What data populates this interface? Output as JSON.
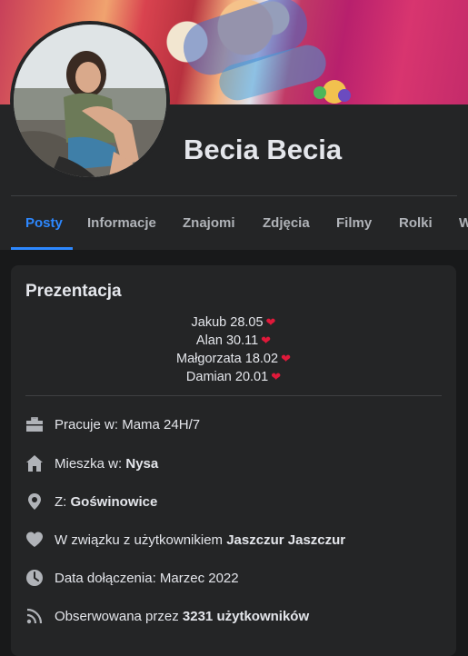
{
  "profile": {
    "name": "Becia Becia"
  },
  "tabs": [
    {
      "label": "Posty",
      "active": true
    },
    {
      "label": "Informacje"
    },
    {
      "label": "Znajomi"
    },
    {
      "label": "Zdjęcia"
    },
    {
      "label": "Filmy"
    },
    {
      "label": "Rolki"
    },
    {
      "label": "W"
    }
  ],
  "intro": {
    "title": "Prezentacja",
    "bio_lines": [
      "Jakub 28.05",
      "Alan 30.11",
      "Małgorzata 18.02",
      "Damian 20.01"
    ],
    "heart": "❤",
    "items": [
      {
        "icon": "briefcase-icon",
        "prefix": "Pracuje w: ",
        "value": "Mama 24H/7",
        "value_bold": false,
        "suffix": ""
      },
      {
        "icon": "home-icon",
        "prefix": "Mieszka w: ",
        "value": "Nysa",
        "value_bold": true,
        "suffix": ""
      },
      {
        "icon": "location-pin-icon",
        "prefix": "Z: ",
        "value": "Goświnowice",
        "value_bold": true,
        "suffix": ""
      },
      {
        "icon": "heart-icon",
        "prefix": "W związku z użytkownikiem ",
        "value": "Jaszczur Jaszczur",
        "value_bold": true,
        "suffix": ""
      },
      {
        "icon": "clock-icon",
        "prefix": "Data dołączenia: ",
        "value": "Marzec 2022",
        "value_bold": false,
        "suffix": ""
      },
      {
        "icon": "rss-icon",
        "prefix": "Obserwowana przez ",
        "value": "3231 użytkowników",
        "value_bold": true,
        "suffix": ""
      }
    ]
  },
  "colors": {
    "background": "#18191a",
    "card": "#242526",
    "accent": "#2d88ff",
    "heart": "#e0193a",
    "icon": "#b0b3b8"
  }
}
